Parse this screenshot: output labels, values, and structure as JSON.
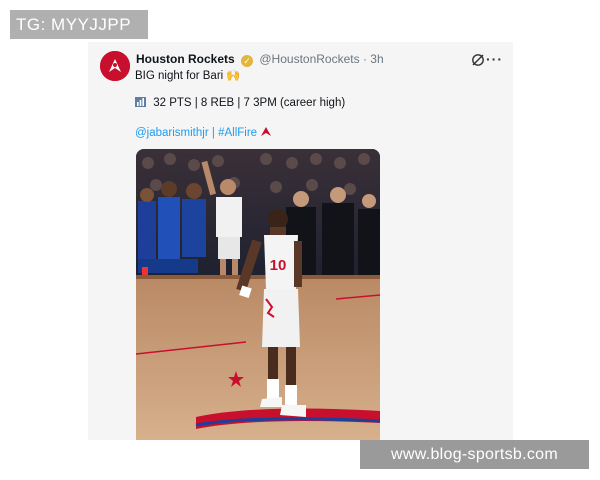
{
  "tg_badge": "TG: MYYJJPP",
  "tweet": {
    "account_name": "Houston Rockets",
    "handle": "@HoustonRockets",
    "separator": "·",
    "time": "3h",
    "line1_text": "BIG night for Bari",
    "line1_emoji": "🙌",
    "stats_line": "32 PTS | 8 REB | 7 3PM (career high)",
    "mention": "@jabarismithjr",
    "divider": "|",
    "hashtag": "#AllFire",
    "more_label": "···",
    "jersey_number": "10"
  },
  "watermark": "www.blog-sportsb.com",
  "colors": {
    "link": "#1d9bf0",
    "rockets_red": "#c8102e",
    "verified_gold": "#e2b53e"
  }
}
